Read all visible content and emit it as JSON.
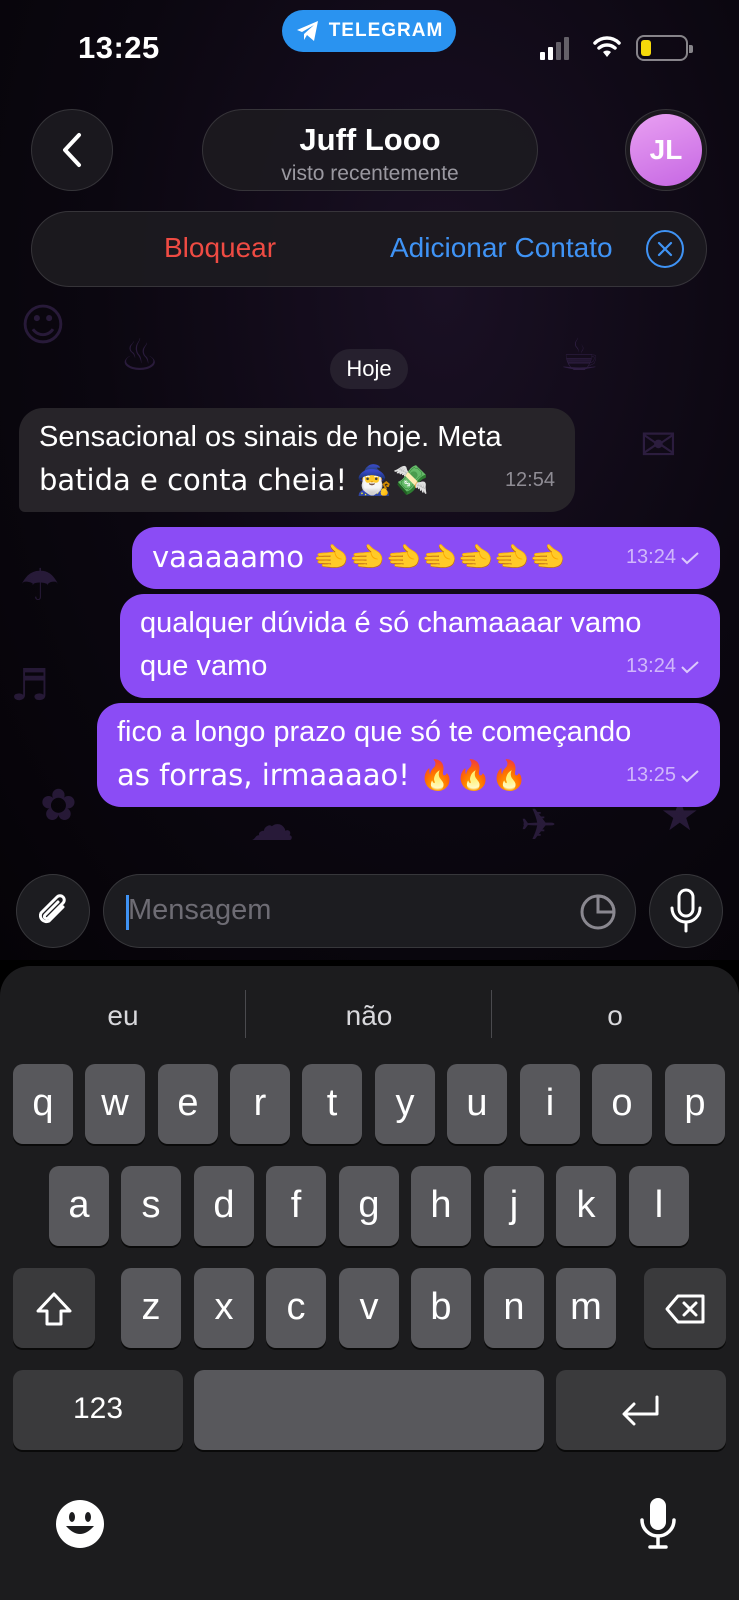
{
  "status_bar": {
    "time": "13:25",
    "app_pill_label": "TELEGRAM",
    "battery_color": "#f5d90a"
  },
  "header": {
    "contact_name": "Juff Looo",
    "contact_status": "visto recentemente",
    "avatar_initials": "JL",
    "back_icon": "chevron-left-icon"
  },
  "action_bar": {
    "block_label": "Bloquear",
    "add_contact_label": "Adicionar Contato"
  },
  "chat": {
    "date_chip": "Hoje",
    "messages": [
      {
        "direction": "in",
        "lines": [
          "Sensacional os sinais de hoje. Meta",
          "batida e conta cheia! 🧙‍♂️💸"
        ],
        "time": "12:54"
      },
      {
        "direction": "out",
        "lines": [
          "vaaaaamo 🫲🫲🫲🫲🫲🫲🫲"
        ],
        "time": "13:24"
      },
      {
        "direction": "out",
        "lines": [
          "qualquer dúvida é só chamaaaar vamo",
          "que vamo"
        ],
        "time": "13:24"
      },
      {
        "direction": "out",
        "lines": [
          "fico a longo prazo que só te começando",
          "as forras, irmaaaao! 🔥🔥🔥"
        ],
        "time": "13:25"
      }
    ]
  },
  "composer": {
    "placeholder": "Mensagem",
    "attach_icon": "paperclip-icon",
    "sticker_icon": "sticker-icon",
    "mic_icon": "microphone-icon"
  },
  "keyboard": {
    "suggestions": [
      "eu",
      "não",
      "o"
    ],
    "row1": [
      "q",
      "w",
      "e",
      "r",
      "t",
      "y",
      "u",
      "i",
      "o",
      "p"
    ],
    "row2": [
      "a",
      "s",
      "d",
      "f",
      "g",
      "h",
      "j",
      "k",
      "l"
    ],
    "row3": [
      "z",
      "x",
      "c",
      "v",
      "b",
      "n",
      "m"
    ],
    "numbers_label": "123",
    "colors": {
      "key": "#58585c",
      "special_key": "#3a3a3c",
      "background": "#1c1c1e"
    }
  },
  "colors": {
    "outgoing_bubble": "#8b4cf5",
    "incoming_bubble": "#272429",
    "accent_blue": "#3f93f5",
    "danger_red": "#ef4b43",
    "telegram_blue": "#2a93f0"
  }
}
